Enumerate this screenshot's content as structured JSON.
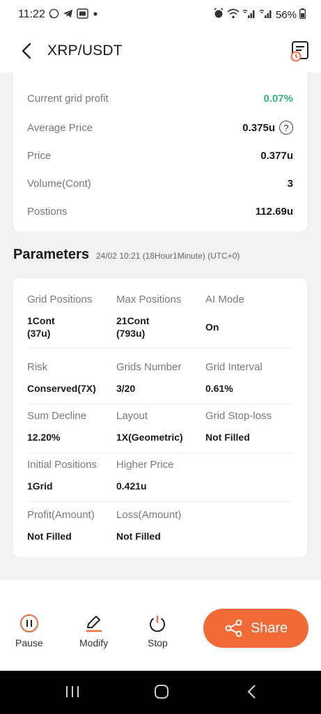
{
  "status": {
    "time": "11:22",
    "left_icons": [
      "whatsapp-icon",
      "telegram-icon",
      "app-icon",
      "dot-icon"
    ],
    "right_icons": [
      "alarm-icon",
      "wifi-icon",
      "signal-icon",
      "signal-icon"
    ],
    "battery": "56%"
  },
  "header": {
    "title": "XRP/USDT"
  },
  "info": {
    "rows": [
      {
        "label": "Current grid profit",
        "value": "0.07%"
      },
      {
        "label": "Average Price",
        "value": "0.375u"
      },
      {
        "label": "Price",
        "value": "0.377u"
      },
      {
        "label": "Volume(Cont)",
        "value": "3"
      },
      {
        "label": "Postions",
        "value": "112.69u"
      }
    ]
  },
  "params": {
    "title": "Parameters",
    "timestamp": "24/02 10:21 (18Hour1Minute) (UTC+0)",
    "rows": [
      [
        {
          "label": "Grid Positions",
          "value": "1Cont\n(37u)"
        },
        {
          "label": "Max Positions",
          "value": "21Cont\n(793u)"
        },
        {
          "label": "AI Mode",
          "value": "On"
        }
      ],
      [
        {
          "label": "Risk",
          "value": "Conserved(7X)"
        },
        {
          "label": "Grids Number",
          "value": "3/20"
        },
        {
          "label": "Grid Interval",
          "value": "0.61%"
        }
      ],
      [
        {
          "label": "Sum Decline",
          "value": "12.20%"
        },
        {
          "label": "Layout",
          "value": "1X(Geometric)"
        },
        {
          "label": "Grid Stop-loss",
          "value": "Not Filled"
        }
      ],
      [
        {
          "label": "Initial Positions",
          "value": "1Grid"
        },
        {
          "label": "Higher Price",
          "value": "0.421u"
        }
      ],
      [
        {
          "label": "Profit(Amount)",
          "value": "Not Filled"
        },
        {
          "label": "Loss(Amount)",
          "value": "Not Filled"
        }
      ]
    ]
  },
  "actions": {
    "pause": "Pause",
    "modify": "Modify",
    "stop": "Stop",
    "share": "Share"
  },
  "colors": {
    "accent": "#f26a36",
    "profit_green": "#36b37e"
  }
}
